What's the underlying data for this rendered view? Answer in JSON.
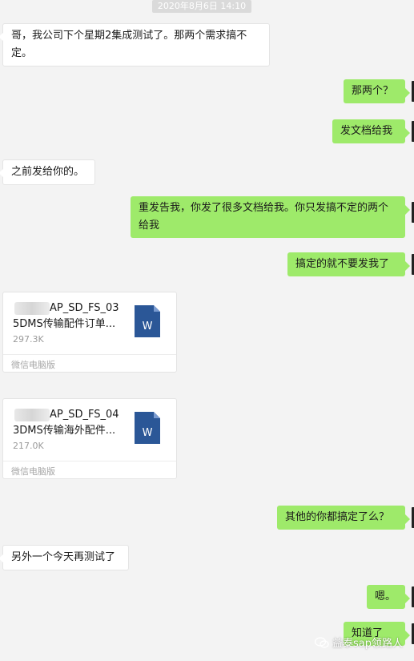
{
  "timestamp": "2020年8月6日 14:10",
  "messages": [
    {
      "side": "left",
      "text": "哥，我公司下个星期2集成测试了。那两个需求搞不定。"
    },
    {
      "side": "right",
      "text": "那两个？"
    },
    {
      "side": "right",
      "text": "发文档给我"
    },
    {
      "side": "left",
      "text": "之前发给你的。"
    },
    {
      "side": "right",
      "text": "重发告我，你发了很多文档给我。你只发搞不定的两个给我"
    },
    {
      "side": "right",
      "text": "搞定的就不要发我了"
    },
    {
      "side": "right",
      "text": "其他的你都搞定了么？"
    },
    {
      "side": "left",
      "text": "另外一个今天再测试了"
    },
    {
      "side": "right",
      "text": "嗯。"
    },
    {
      "side": "right",
      "text": "知道了"
    }
  ],
  "files": [
    {
      "name_line1": "AP_SD_FS_03",
      "name_line2": "5DMS传输配件订单...",
      "size": "297.3K",
      "source": "微信电脑版",
      "icon": "word-doc-icon",
      "icon_letter": "W"
    },
    {
      "name_line1": "AP_SD_FS_04",
      "name_line2": "3DMS传输海外配件...",
      "size": "217.0K",
      "source": "微信电脑版",
      "icon": "word-doc-icon",
      "icon_letter": "W"
    }
  ],
  "watermark": "益泰sap领路人",
  "colors": {
    "background": "#f3f3f3",
    "bubble_sent": "#9eea6a",
    "bubble_received": "#ffffff",
    "word_blue": "#2b5797"
  }
}
